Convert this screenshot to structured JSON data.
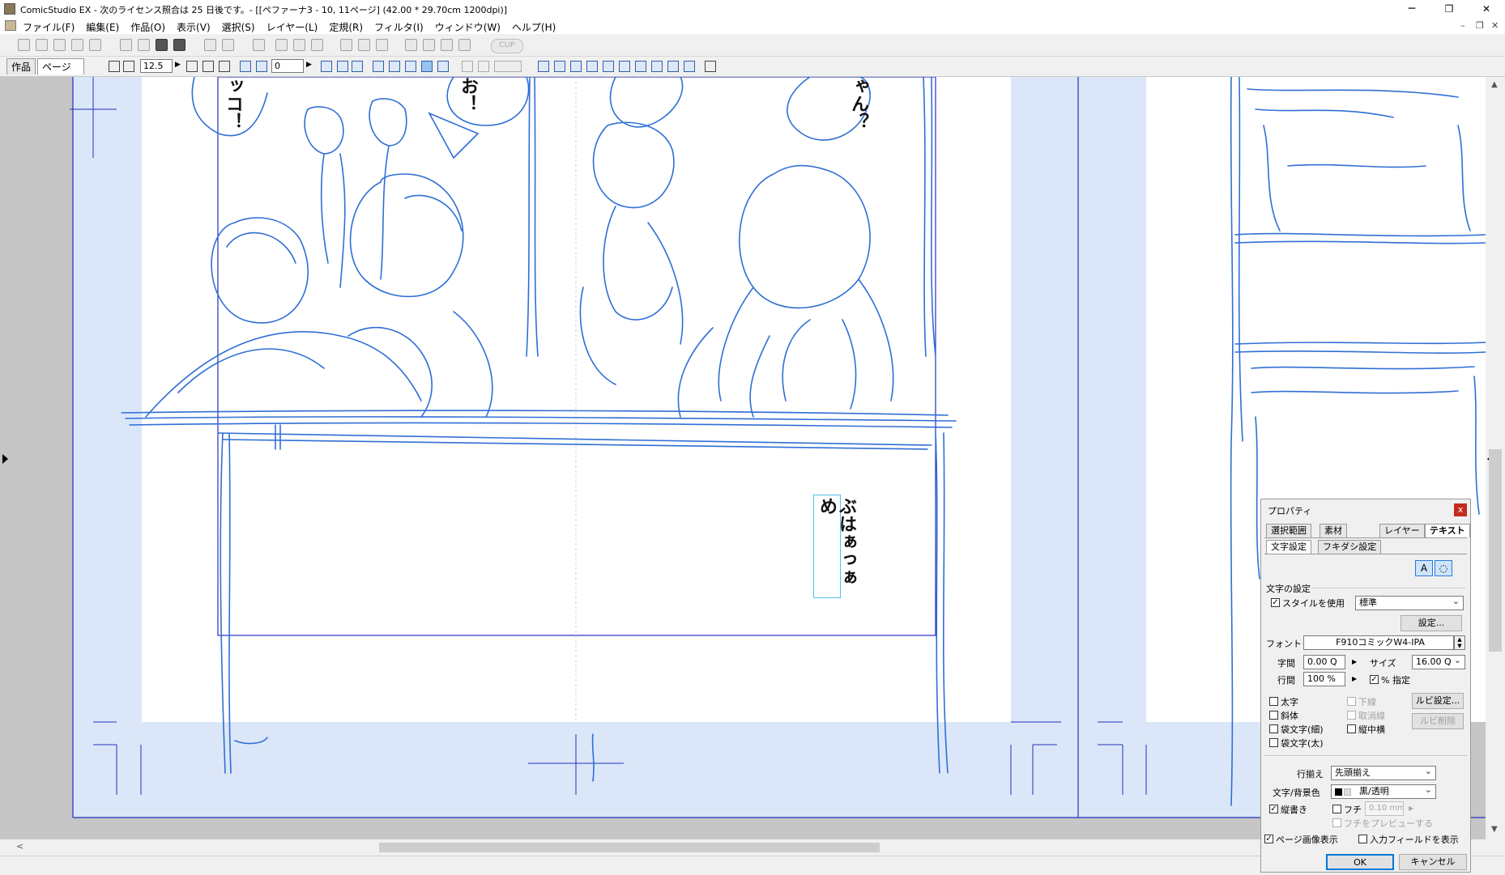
{
  "window": {
    "title": "ComicStudio EX - 次のライセンス照合は 25 日後です。- [[ペファーナ3 - 10, 11ページ] (42.00 * 29.70cm 1200dpi)]",
    "minimize": "─",
    "maximize": "❐",
    "close": "✕"
  },
  "menu": {
    "items": [
      "ファイル(F)",
      "編集(E)",
      "作品(O)",
      "表示(V)",
      "選択(S)",
      "レイヤー(L)",
      "定規(R)",
      "フィルタ(I)",
      "ウィンドウ(W)",
      "ヘルプ(H)"
    ],
    "mdi_min": "–",
    "mdi_restore": "❐",
    "mdi_close": "✕"
  },
  "toolbar": {
    "clip_label": "CLIP"
  },
  "tabs": {
    "work": "作品",
    "page": "ページ",
    "page_close": "✕"
  },
  "toolbar2": {
    "zoom_value": "12.5",
    "rotate_value": "0"
  },
  "canvas": {
    "text_tsukko": "ッコ！",
    "text_oo": "お！",
    "text_yan": "ゃん？",
    "text_buhaa": "ぶはぁっぁめ"
  },
  "properties": {
    "title": "プロパティ",
    "close": "x",
    "tabs": [
      "選択範囲",
      "素材",
      "レイヤー",
      "テキスト"
    ],
    "active_tab": "テキスト",
    "subtabs": [
      "文字設定",
      "フキダシ設定"
    ],
    "section_title": "文字の設定",
    "use_style_label": "スタイルを使用",
    "use_style_checked": true,
    "style_value": "標準",
    "settings_button": "設定...",
    "font_label": "フォント",
    "font_value": "F910コミックW4-IPA",
    "char_spacing_label": "字間",
    "char_spacing_value": "0.00 Q",
    "size_label": "サイズ",
    "size_value": "16.00 Q",
    "line_spacing_label": "行間",
    "line_spacing_value": "100 %",
    "percent_label": "% 指定",
    "percent_checked": true,
    "bold_label": "太字",
    "italic_label": "斜体",
    "outline_thin_label": "袋文字(細)",
    "outline_thick_label": "袋文字(太)",
    "underline_label": "下線",
    "strike_label": "取消線",
    "tatechuyoko_label": "縦中横",
    "ruby_settings_button": "ルビ設定...",
    "ruby_delete_button": "ルビ削除",
    "align_label": "行揃え",
    "align_value": "先頭揃え",
    "color_label": "文字/背景色",
    "color_value": "黒/透明",
    "vertical_label": "縦書き",
    "vertical_checked": true,
    "edge_label": "フチ",
    "edge_value": "0.10 mm",
    "edge_preview_label": "フチをプレビューする",
    "show_page_label": "ページ画像表示",
    "show_page_checked": true,
    "show_input_label": "入力フィールドを表示",
    "show_input_checked": false,
    "ok_button": "OK",
    "cancel_button": "キャンセル"
  },
  "colors": {
    "sketch_blue": "#2f6fd6",
    "frame_blue": "#2030c0",
    "bleed_area": "#dbe7f8",
    "page_white": "#ffffff",
    "canvas_gray": "#c6c6c6"
  }
}
